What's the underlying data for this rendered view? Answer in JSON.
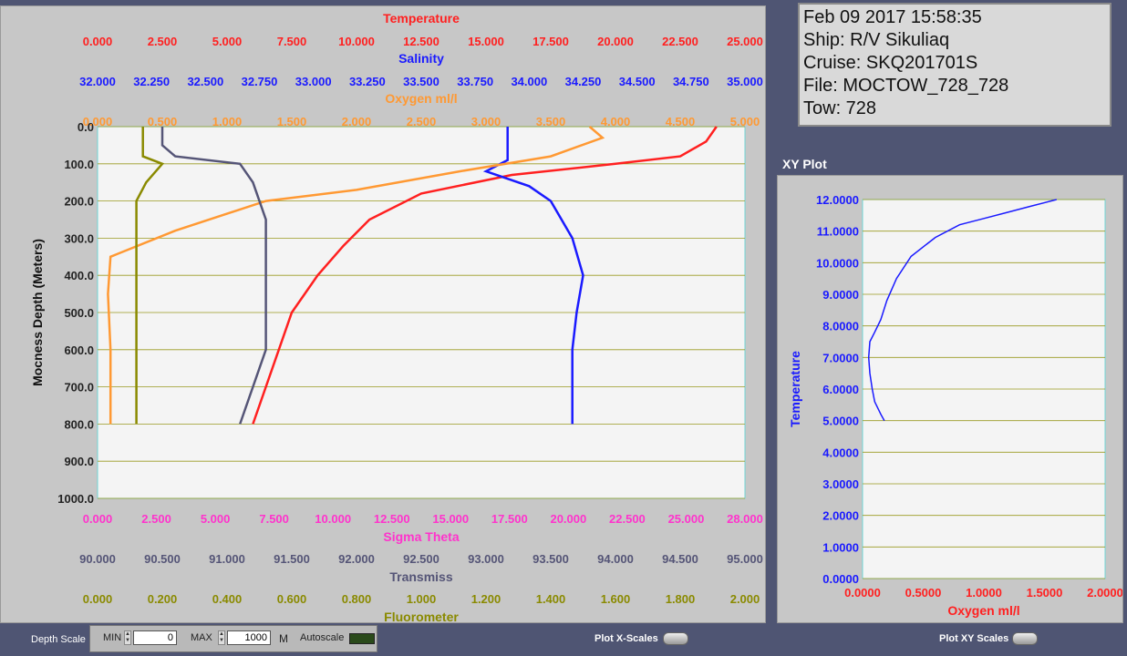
{
  "info": {
    "datetime": "Feb 09 2017 15:58:35",
    "ship": "Ship: R/V Sikuliaq",
    "cruise": "Cruise: SKQ201701S",
    "file": "File: MOCTOW_728_728",
    "tow": "Tow: 728"
  },
  "xy_title": "XY Plot",
  "chart_data": [
    {
      "type": "line",
      "ylabel": "Mocness Depth (Meters)",
      "ylim": [
        1000,
        0
      ],
      "y_ticks": [
        "0.0",
        "100.0",
        "200.0",
        "300.0",
        "400.0",
        "500.0",
        "600.0",
        "700.0",
        "800.0",
        "900.0",
        "1000.0"
      ],
      "grid": true,
      "top_axes": [
        {
          "name": "Temperature",
          "color": "#ff2020",
          "range": [
            0,
            25
          ],
          "ticks": [
            "0.000",
            "2.500",
            "5.000",
            "7.500",
            "10.000",
            "12.500",
            "15.000",
            "17.500",
            "20.000",
            "22.500",
            "25.000"
          ]
        },
        {
          "name": "Salinity",
          "color": "#1a1aff",
          "range": [
            32,
            35
          ],
          "ticks": [
            "32.000",
            "32.250",
            "32.500",
            "32.750",
            "33.000",
            "33.250",
            "33.500",
            "33.750",
            "34.000",
            "34.250",
            "34.500",
            "34.750",
            "35.000"
          ]
        },
        {
          "name": "Oxygen ml/l",
          "color": "#ff9933",
          "range": [
            0,
            5
          ],
          "ticks": [
            "0.000",
            "0.500",
            "1.000",
            "1.500",
            "2.000",
            "2.500",
            "3.000",
            "3.500",
            "4.000",
            "4.500",
            "5.000"
          ]
        }
      ],
      "bottom_axes": [
        {
          "name": "Sigma Theta",
          "color": "#ff33cc",
          "range": [
            0,
            28
          ],
          "ticks": [
            "0.000",
            "2.500",
            "5.000",
            "7.500",
            "10.000",
            "12.500",
            "15.000",
            "17.500",
            "20.000",
            "22.500",
            "25.000",
            "28.000"
          ]
        },
        {
          "name": "Transmiss",
          "color": "#555577",
          "range": [
            90,
            95
          ],
          "ticks": [
            "90.000",
            "90.500",
            "91.000",
            "91.500",
            "92.000",
            "92.500",
            "93.000",
            "93.500",
            "94.000",
            "94.500",
            "95.000"
          ]
        },
        {
          "name": "Fluorometer",
          "color": "#8a8a00",
          "range": [
            0,
            2
          ],
          "ticks": [
            "0.000",
            "0.200",
            "0.400",
            "0.600",
            "0.800",
            "1.000",
            "1.200",
            "1.400",
            "1.600",
            "1.800",
            "2.000"
          ]
        }
      ],
      "series": [
        {
          "name": "Temperature",
          "color": "#ff2020",
          "points": [
            [
              23.9,
              0
            ],
            [
              23.5,
              40
            ],
            [
              22.5,
              80
            ],
            [
              20,
              100
            ],
            [
              16,
              130
            ],
            [
              12.5,
              180
            ],
            [
              10.5,
              250
            ],
            [
              9.5,
              320
            ],
            [
              8.5,
              400
            ],
            [
              7.5,
              500
            ],
            [
              7,
              600
            ],
            [
              6.5,
              700
            ],
            [
              6,
              800
            ]
          ]
        },
        {
          "name": "Salinity",
          "color": "#1a1aff",
          "points": [
            [
              33.9,
              0
            ],
            [
              33.9,
              50
            ],
            [
              33.9,
              90
            ],
            [
              33.8,
              120
            ],
            [
              34.0,
              160
            ],
            [
              34.1,
              200
            ],
            [
              34.2,
              300
            ],
            [
              34.25,
              400
            ],
            [
              34.22,
              500
            ],
            [
              34.2,
              600
            ],
            [
              34.2,
              700
            ],
            [
              34.2,
              800
            ]
          ]
        },
        {
          "name": "Oxygen ml/l",
          "color": "#ff9933",
          "points": [
            [
              3.8,
              0
            ],
            [
              3.9,
              30
            ],
            [
              3.5,
              80
            ],
            [
              2.8,
              120
            ],
            [
              2.0,
              170
            ],
            [
              1.3,
              200
            ],
            [
              0.6,
              280
            ],
            [
              0.1,
              350
            ],
            [
              0.08,
              450
            ],
            [
              0.1,
              600
            ],
            [
              0.1,
              800
            ]
          ]
        },
        {
          "name": "Transmiss",
          "color": "#555577",
          "points": [
            [
              90.5,
              0
            ],
            [
              90.5,
              50
            ],
            [
              90.6,
              80
            ],
            [
              91.1,
              100
            ],
            [
              91.2,
              150
            ],
            [
              91.3,
              250
            ],
            [
              91.3,
              400
            ],
            [
              91.3,
              600
            ],
            [
              91.2,
              700
            ],
            [
              91.1,
              800
            ]
          ]
        },
        {
          "name": "Fluorometer",
          "color": "#8a8a00",
          "points": [
            [
              0.14,
              0
            ],
            [
              0.14,
              80
            ],
            [
              0.2,
              100
            ],
            [
              0.15,
              150
            ],
            [
              0.12,
              200
            ],
            [
              0.12,
              400
            ],
            [
              0.12,
              600
            ],
            [
              0.12,
              800
            ]
          ]
        }
      ]
    },
    {
      "type": "line",
      "xlabel": "Oxygen ml/l",
      "ylabel": "Temperature",
      "xlim": [
        0,
        2
      ],
      "ylim": [
        0,
        12
      ],
      "x_ticks": [
        "0.0000",
        "0.5000",
        "1.0000",
        "1.5000",
        "2.0000"
      ],
      "y_ticks": [
        "0.0000",
        "1.0000",
        "2.0000",
        "3.0000",
        "4.0000",
        "5.0000",
        "6.0000",
        "7.0000",
        "8.0000",
        "9.0000",
        "10.0000",
        "11.0000",
        "12.0000"
      ],
      "grid": true,
      "series": [
        {
          "color": "#1a1aff",
          "points": [
            [
              0.18,
              5.0
            ],
            [
              0.15,
              5.2
            ],
            [
              0.1,
              5.6
            ],
            [
              0.08,
              6.0
            ],
            [
              0.06,
              6.5
            ],
            [
              0.05,
              7.0
            ],
            [
              0.06,
              7.5
            ],
            [
              0.1,
              7.8
            ],
            [
              0.15,
              8.2
            ],
            [
              0.2,
              8.8
            ],
            [
              0.28,
              9.5
            ],
            [
              0.4,
              10.2
            ],
            [
              0.6,
              10.8
            ],
            [
              0.8,
              11.2
            ],
            [
              1.0,
              11.4
            ],
            [
              1.2,
              11.6
            ],
            [
              1.4,
              11.8
            ],
            [
              1.6,
              12.0
            ]
          ]
        }
      ]
    }
  ],
  "controls": {
    "depth_scale": "Depth Scale",
    "min_label": "MIN",
    "min_value": "0",
    "max_label": "MAX",
    "max_value": "1000",
    "unit": "M",
    "autoscale": "Autoscale",
    "plot_x_scales": "Plot X-Scales",
    "plot_xy_scales": "Plot XY Scales"
  }
}
